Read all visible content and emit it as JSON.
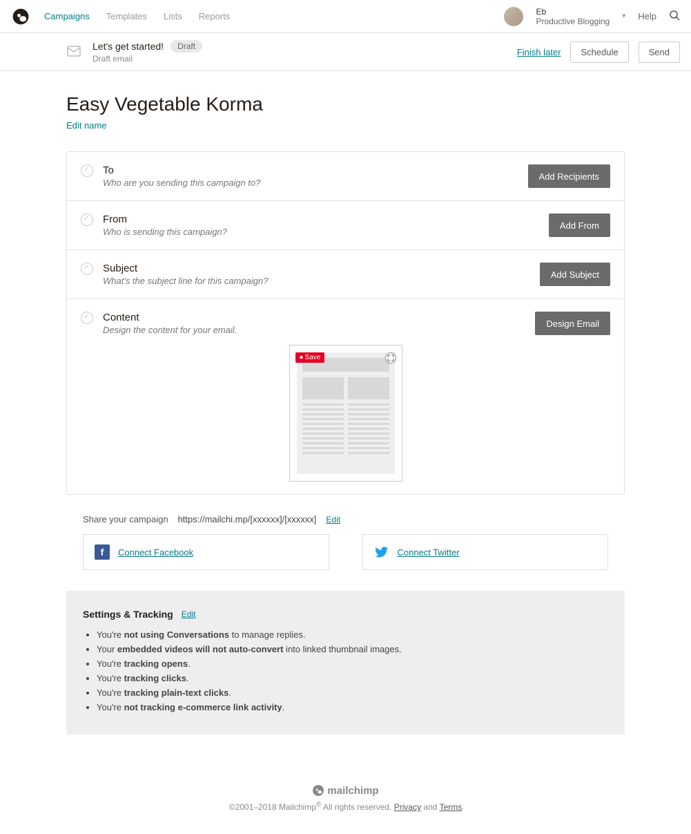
{
  "nav": {
    "items": [
      "Campaigns",
      "Templates",
      "Lists",
      "Reports"
    ],
    "active": "Campaigns",
    "user_name": "Eb",
    "user_org": "Productive Blogging",
    "help": "Help"
  },
  "subheader": {
    "title": "Let's get started!",
    "badge": "Draft",
    "subtitle": "Draft email",
    "finish_later": "Finish later",
    "schedule": "Schedule",
    "send": "Send"
  },
  "page": {
    "title": "Easy Vegetable Korma",
    "edit_name": "Edit name"
  },
  "sections": {
    "to": {
      "label": "To",
      "desc": "Who are you sending this campaign to?",
      "btn": "Add Recipients"
    },
    "from": {
      "label": "From",
      "desc": "Who is sending this campaign?",
      "btn": "Add From"
    },
    "subject": {
      "label": "Subject",
      "desc": "What's the subject line for this campaign?",
      "btn": "Add Subject"
    },
    "content": {
      "label": "Content",
      "desc": "Design the content for your email.",
      "btn": "Design Email",
      "save_badge": "Save"
    }
  },
  "share": {
    "label": "Share your campaign",
    "url": "https://mailchi.mp/[xxxxxx]/[xxxxxx]",
    "edit": "Edit",
    "fb": "Connect Facebook",
    "tw": "Connect Twitter"
  },
  "settings": {
    "title": "Settings & Tracking",
    "edit": "Edit",
    "items": [
      {
        "pre": "You're ",
        "bold": "not using Conversations",
        "post": " to manage replies."
      },
      {
        "pre": "Your ",
        "bold": "embedded videos will not auto-convert",
        "post": " into linked thumbnail images."
      },
      {
        "pre": "You're ",
        "bold": "tracking opens",
        "post": "."
      },
      {
        "pre": "You're ",
        "bold": "tracking clicks",
        "post": "."
      },
      {
        "pre": "You're ",
        "bold": "tracking plain-text clicks",
        "post": "."
      },
      {
        "pre": "You're ",
        "bold": "not tracking e-commerce link activity",
        "post": "."
      }
    ]
  },
  "footer": {
    "brand": "mailchimp",
    "copyright": "©2001–2018 Mailchimp",
    "rights": " All rights reserved. ",
    "privacy": "Privacy",
    "and": " and ",
    "terms": "Terms"
  }
}
